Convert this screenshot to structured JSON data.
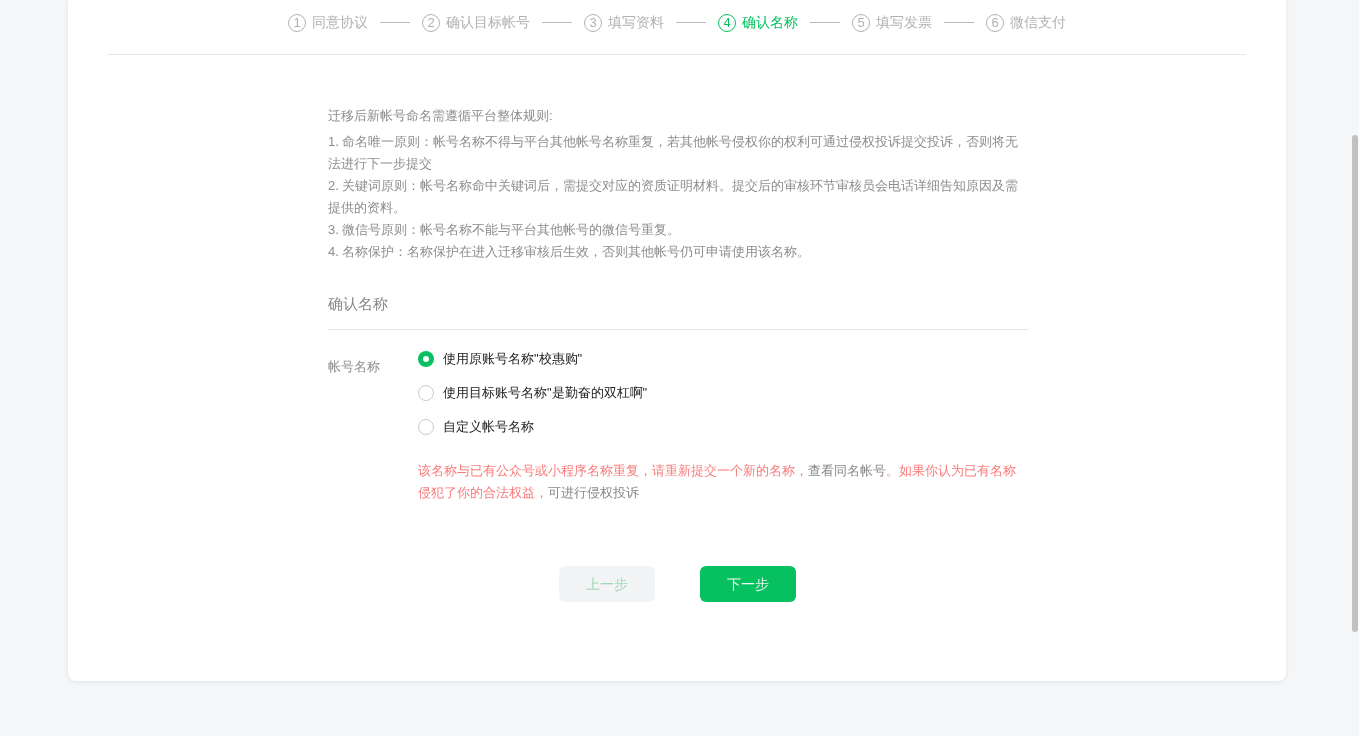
{
  "steps": [
    {
      "number": "1",
      "label": "同意协议",
      "selected": false
    },
    {
      "number": "2",
      "label": "确认目标帐号",
      "selected": false
    },
    {
      "number": "3",
      "label": "填写资料",
      "selected": false
    },
    {
      "number": "4",
      "label": "确认名称",
      "selected": true
    },
    {
      "number": "5",
      "label": "填写发票",
      "selected": false
    },
    {
      "number": "6",
      "label": "微信支付",
      "selected": false
    }
  ],
  "rules": {
    "title": "迁移后新帐号命名需遵循平台整体规则:",
    "items": [
      "1. 命名唯一原则：帐号名称不得与平台其他帐号名称重复，若其他帐号侵权你的权利可通过侵权投诉提交投诉，否则将无法进行下一步提交",
      "2. 关键词原则：帐号名称命中关键词后，需提交对应的资质证明材料。提交后的审核环节审核员会电话详细告知原因及需提供的资料。",
      "3. 微信号原则：帐号名称不能与平台其他帐号的微信号重复。",
      "4. 名称保护：名称保护在进入迁移审核后生效，否则其他帐号仍可申请使用该名称。"
    ]
  },
  "section_title": "确认名称",
  "name_field": {
    "label": "帐号名称",
    "options": [
      {
        "label": "使用原账号名称\"校惠购\"",
        "selected": true
      },
      {
        "label": "使用目标账号名称\"是勤奋的双杠啊\"",
        "selected": false
      },
      {
        "label": "自定义帐号名称",
        "selected": false
      }
    ]
  },
  "error": [
    {
      "kind": "text",
      "text": "该名称与已有公众号或小程序名称重复，请重新提交一个新的名称，"
    },
    {
      "kind": "link",
      "text": "查看同名帐号"
    },
    {
      "kind": "text",
      "text": "。如果你认为已有名称侵犯了你的合法权益，"
    },
    {
      "kind": "link",
      "text": "可进行侵权投诉"
    }
  ],
  "buttons": [
    {
      "label": "上一步",
      "disabled": true
    },
    {
      "label": "下一步",
      "disabled": false
    }
  ]
}
